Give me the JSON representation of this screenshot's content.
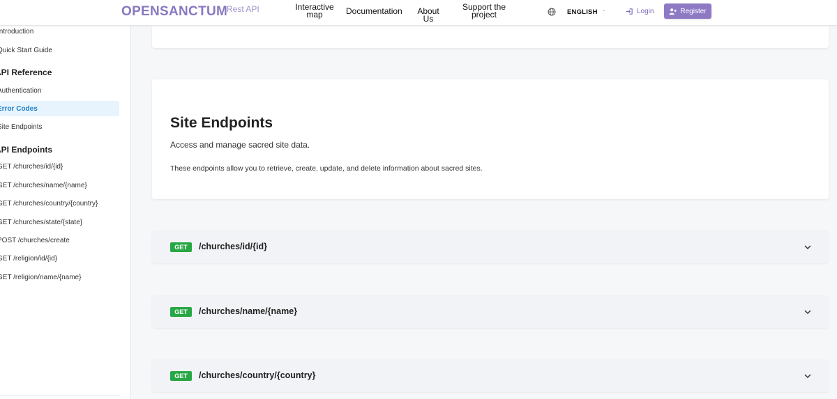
{
  "header": {
    "brand": "OPENSANCTUM",
    "brand_sub": "Rest API",
    "nav": {
      "interactive_map": "Interactive map",
      "documentation": "Documentation",
      "about": "About Us",
      "support": "Support the project"
    },
    "language": "ENGLISH",
    "language_caret": "-",
    "login": "Login",
    "register": "Register",
    "accent_color": "#8e7ac4"
  },
  "sidebar": {
    "items_top": [
      "Introduction",
      "Quick Start Guide"
    ],
    "section_reference": "API Reference",
    "reference_items": [
      "Authentication",
      "Error Codes",
      "Site Endpoints"
    ],
    "active_item": "Error Codes",
    "section_endpoints": "API Endpoints",
    "endpoint_items": [
      "GET /churches/id/{id}",
      "GET /churches/name/{name}",
      "GET /churches/country/{country}",
      "GET /churches/state/{state}",
      "POST /churches/create",
      "GET /religion/id/{id}",
      "GET /religion/name/{name}"
    ]
  },
  "main": {
    "section_title": "Site Endpoints",
    "section_desc": "Access and manage sacred site data.",
    "section_note": "These endpoints allow you to retrieve, create, update, and delete information about sacred sites.",
    "endpoints": [
      {
        "method": "GET",
        "path": "/churches/id/{id}"
      },
      {
        "method": "GET",
        "path": "/churches/name/{name}"
      },
      {
        "method": "GET",
        "path": "/churches/country/{country}"
      }
    ],
    "method_color": "#28a745"
  }
}
